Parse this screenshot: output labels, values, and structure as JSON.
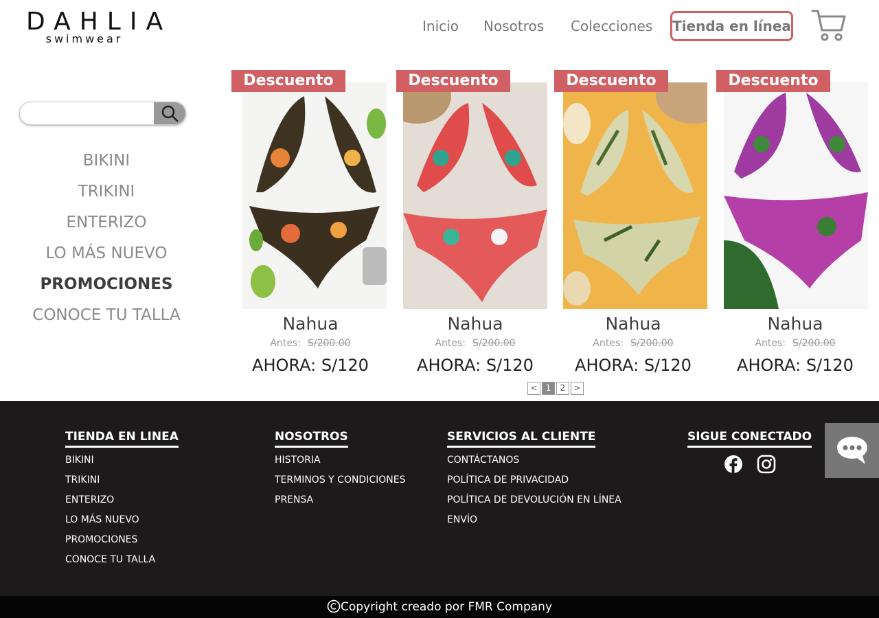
{
  "logo": {
    "brand": "DAHLIA",
    "sub": "swimwear"
  },
  "nav": {
    "inicio": "Inicio",
    "nosotros": "Nosotros",
    "colecciones": "Colecciones",
    "tienda": "Tienda en línea"
  },
  "search": {
    "placeholder": ""
  },
  "categories": [
    "BIKINI",
    "TRIKINI",
    "ENTERIZO",
    "LO MÁS NUEVO",
    "PROMOCIONES",
    "CONOCE TU TALLA"
  ],
  "products": [
    {
      "badge": "Descuento",
      "name": "Nahua",
      "before_label": "Antes:",
      "before_price": "S/200.00",
      "now": "AHORA: S/120"
    },
    {
      "badge": "Descuento",
      "name": "Nahua",
      "before_label": "Antes:",
      "before_price": "S/200.00",
      "now": "AHORA: S/120"
    },
    {
      "badge": "Descuento",
      "name": "Nahua",
      "before_label": "Antes:",
      "before_price": "S/200.00",
      "now": "AHORA: S/120"
    },
    {
      "badge": "Descuento",
      "name": "Nahua",
      "before_label": "Antes:",
      "before_price": "S/200.00",
      "now": "AHORA: S/120"
    }
  ],
  "pager": {
    "prev": "<",
    "p1": "1",
    "p2": "2",
    "next": ">"
  },
  "footer": {
    "col1": {
      "title": "TIENDA EN LINEA",
      "links": [
        "BIKINI",
        "TRIKINI",
        "ENTERIZO",
        "LO MÁS NUEVO",
        "PROMOCIONES",
        "CONOCE TU TALLA"
      ]
    },
    "col2": {
      "title": "NOSOTROS",
      "links": [
        "HISTORIA",
        "TERMINOS Y CONDICIONES",
        "PRENSA"
      ]
    },
    "col3": {
      "title": "SERVICIOS AL CLIENTE",
      "links": [
        "CONTÁCTANOS",
        "POLÍTICA DE PRIVACIDAD",
        "POLÍTICA DE DEVOLUCIÓN EN LÍNEA",
        "ENVÍO"
      ]
    },
    "col4": {
      "title": "SIGUE CONECTADO"
    },
    "copyright": "Copyright creado por FMR Company"
  },
  "colors": {
    "accent": "#d06063",
    "footer_bg": "#1c1a1b"
  },
  "icons": {
    "cart": "cart-icon",
    "search": "search-icon",
    "facebook": "facebook-icon",
    "instagram": "instagram-icon",
    "chat": "chat-icon",
    "copyright": "copyright-icon"
  }
}
